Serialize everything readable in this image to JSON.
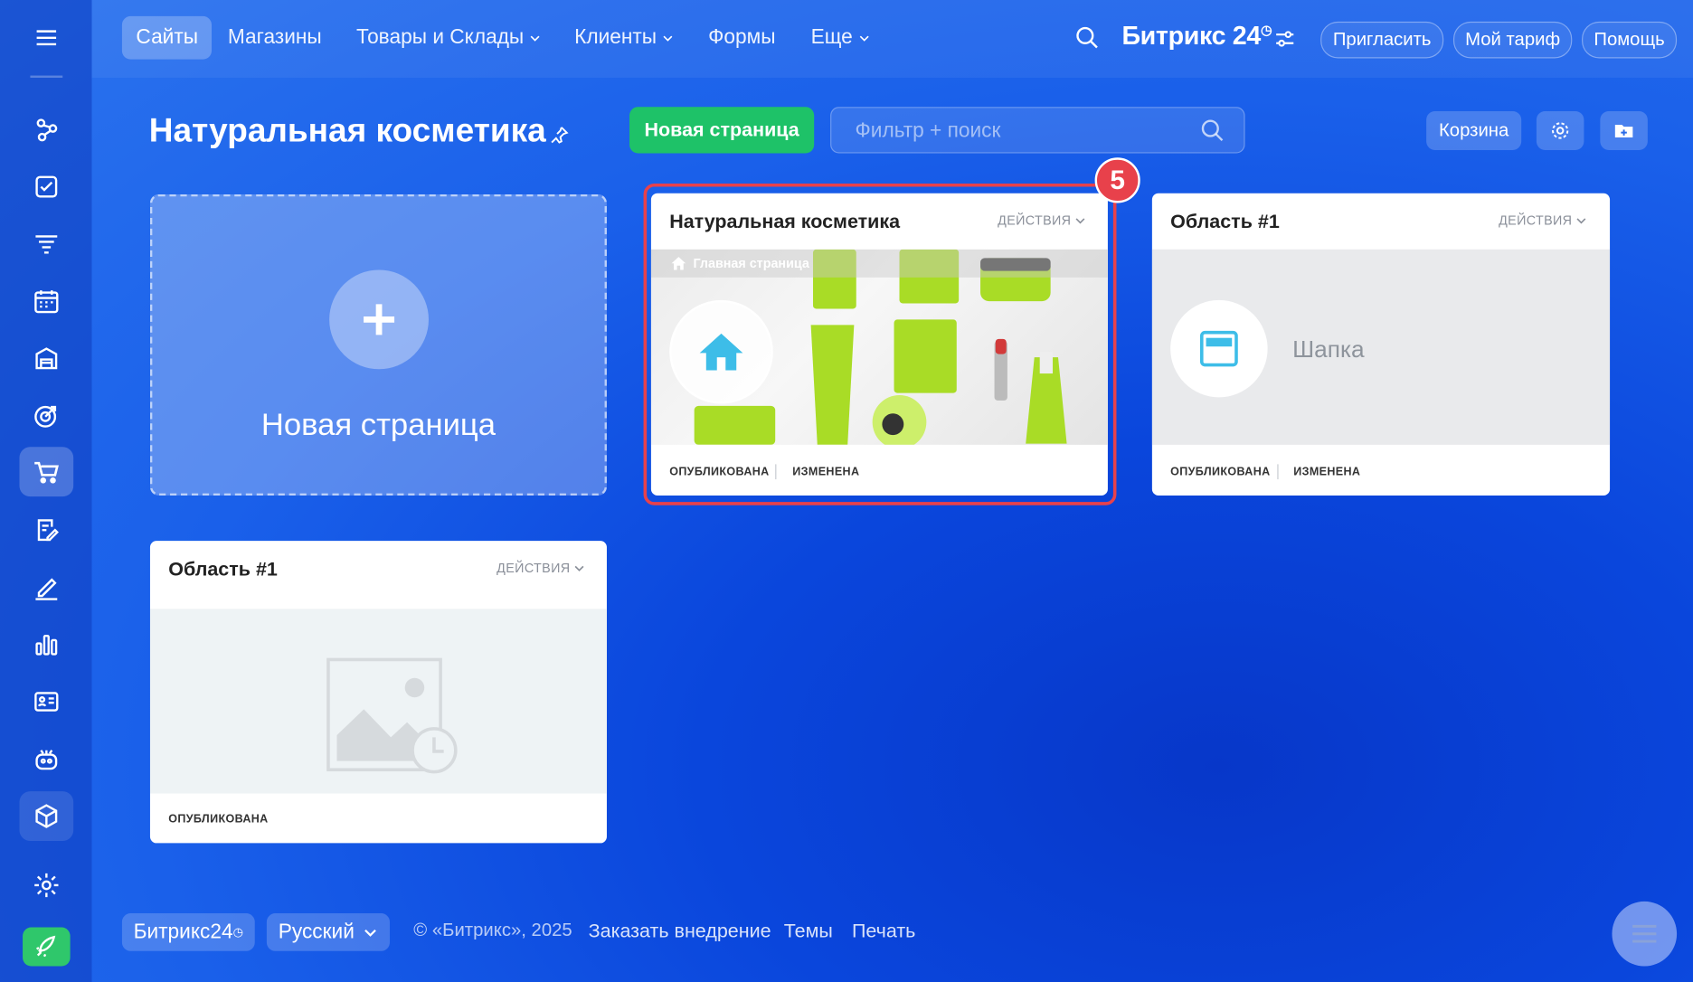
{
  "topnav": {
    "items": [
      {
        "label": "Сайты"
      },
      {
        "label": "Магазины"
      },
      {
        "label": "Товары и Склады"
      },
      {
        "label": "Клиенты"
      },
      {
        "label": "Формы"
      },
      {
        "label": "Еще"
      }
    ],
    "logo": "Битрикс 24",
    "invite": "Пригласить",
    "tariff": "Мой тариф",
    "help": "Помощь"
  },
  "page": {
    "title": "Натуральная косметика",
    "new_page_button": "Новая страница",
    "search_placeholder": "Фильтр + поиск",
    "trash_button": "Корзина"
  },
  "new_page_tile": {
    "label": "Новая страница"
  },
  "cards": [
    {
      "title": "Натуральная косметика",
      "actions": "ДЕЙСТВИЯ",
      "home_badge": "Главная страница",
      "status_published": "ОПУБЛИКОВАНА",
      "status_changed": "ИЗМЕНЕНА"
    },
    {
      "title": "Область #1",
      "actions": "ДЕЙСТВИЯ",
      "preview_label": "Шапка",
      "status_published": "ОПУБЛИКОВАНА",
      "status_changed": "ИЗМЕНЕНА"
    },
    {
      "title": "Область #1",
      "actions": "ДЕЙСТВИЯ",
      "status_published": "ОПУБЛИКОВАНА"
    }
  ],
  "step_badge": "5",
  "footer": {
    "brand": "Битрикс24",
    "language": "Русский",
    "copyright": "© «Битрикс», 2025",
    "links": [
      "Заказать внедрение",
      "Темы",
      "Печать"
    ]
  },
  "colors": {
    "accent_green": "#1ec268",
    "highlight_red": "#e8414b",
    "background_blue": "#0a46dc"
  }
}
